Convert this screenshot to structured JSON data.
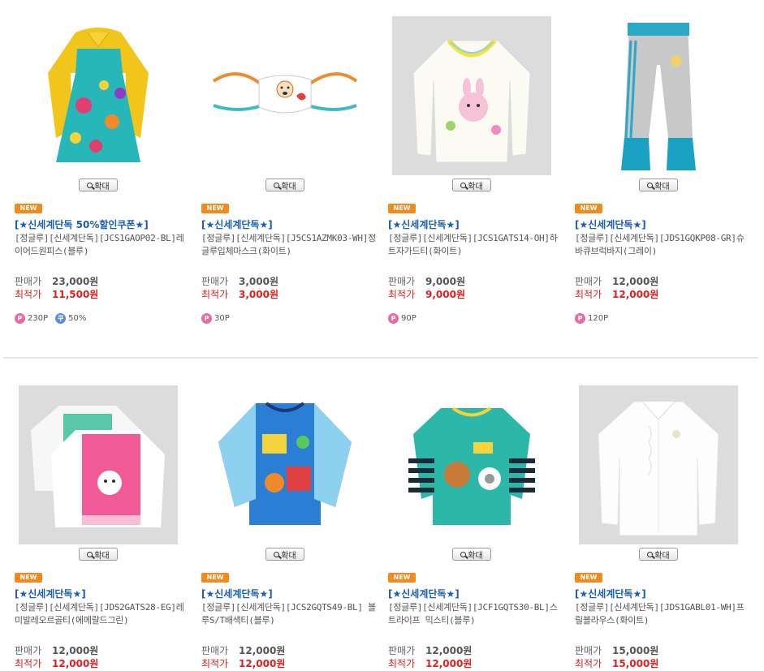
{
  "zoom_label": "확대",
  "new_label": "NEW",
  "price_label": "판매가",
  "best_label": "최적가",
  "products": [
    {
      "promo": "[★신세계단독 50%할인쿠폰★]",
      "name": "[정글루][신세계단독][JCS1GAOP02-BL]레이어드원피스(블루)",
      "price": "23,000원",
      "best": "11,500원",
      "points": "230P",
      "coupon": "50%",
      "image": "yellow-teal-dress"
    },
    {
      "promo": "[★신세계단독★]",
      "name": "[정글루][신세계단독][J5CS1AZMK03-WH]정글루입체마스크(화이트)",
      "price": "3,000원",
      "best": "3,000원",
      "points": "30P",
      "coupon": "",
      "image": "white-mask"
    },
    {
      "promo": "[★신세계단독★]",
      "name": "[정글루][신세계단독][JCS1GATS14-OH]하트자가드티(화이트)",
      "price": "9,000원",
      "best": "9,000원",
      "points": "90P",
      "coupon": "",
      "image": "white-long-sleeve-tee"
    },
    {
      "promo": "[★신세계단독★]",
      "name": "[정글루][신세계단독][JDS1GQKP08-GR]슈바큐브럭바지(그레이)",
      "price": "12,000원",
      "best": "12,000원",
      "points": "120P",
      "coupon": "",
      "image": "gray-blue-pants"
    },
    {
      "promo": "[★신세계단독★]",
      "name": "[정글루][신세계단독][JDS2GATS28-EG]레미발레오르골티(에메랄드그린)",
      "price": "12,000원",
      "best": "12,000원",
      "points": "",
      "coupon": "",
      "image": "pink-green-layered-tees"
    },
    {
      "promo": "[★신세계단독★]",
      "name": "[정글루][신세계단독][JCS2GQTS49-BL] 블루S/T배색티(블루)",
      "price": "12,000원",
      "best": "12,000원",
      "points": "",
      "coupon": "",
      "image": "blue-print-tee"
    },
    {
      "promo": "[★신세계단독★]",
      "name": "[정글루][신세계단독][JCF1GQTS30-BL]스트라이프 믹스티(블루)",
      "price": "12,000원",
      "best": "12,000원",
      "points": "",
      "coupon": "",
      "image": "teal-striped-tee"
    },
    {
      "promo": "[★신세계단독★]",
      "name": "[정글루][신세계단독][JDS1GABL01-WH]프릴블라우스(화이트)",
      "price": "15,000원",
      "best": "15,000원",
      "points": "",
      "coupon": "",
      "image": "white-blouse"
    }
  ]
}
